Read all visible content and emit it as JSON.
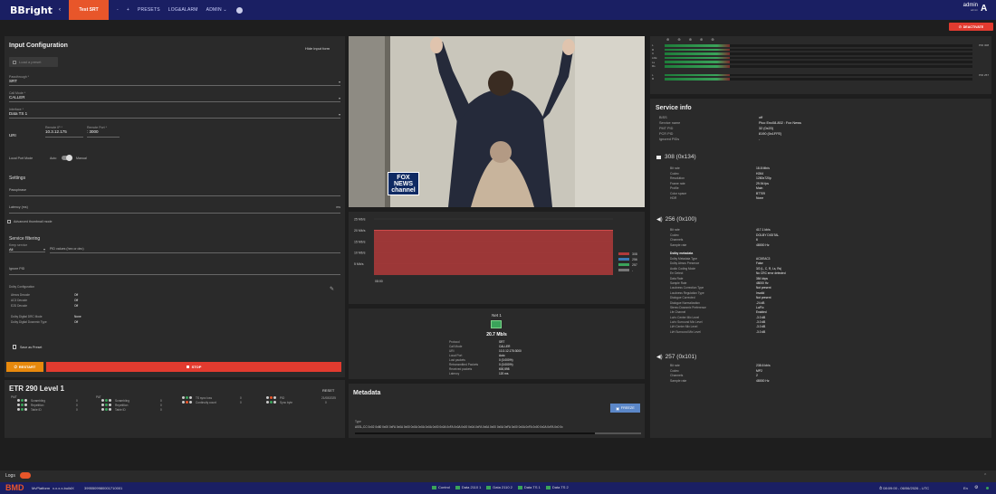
{
  "app": {
    "logo": "BBright",
    "back_icon": "‹",
    "active_tab": "Test SRT",
    "nav": [
      "-",
      "+",
      "PRESETS",
      "LOG&ALARM",
      "ADMIN ⌄"
    ],
    "user": "admin",
    "user_role": "admin",
    "avatar": "A",
    "deactivate": "DEACTIVATE"
  },
  "input": {
    "title": "Input Configuration",
    "hide_link": "Hide input form",
    "load_preset": "Load a preset",
    "fields": [
      {
        "label": "Passthrough *",
        "value": "SRT"
      },
      {
        "label": "Call Mode *",
        "value": "CALLER"
      },
      {
        "label": "Interface *",
        "value": "Data TS 1"
      }
    ],
    "uri_label": "URI",
    "remote_ip_label": "Remote IP *",
    "remote_ip": "10.3.12.175",
    "remote_port_label": "Remote Port *",
    "remote_port": ": 3000",
    "local_port_mode": "Local Port Mode",
    "auto": "Auto",
    "manual": "Manual",
    "settings": "Settings",
    "passphrase": "Passphrase",
    "latency": "Latency (ms)",
    "latency_unit": "ms",
    "adv_thumb": "Advanced thumbnail mode",
    "service_filtering": "Service filtering",
    "keep_service": "Keep service",
    "filter_value": "All",
    "pid_placeholder": "PID values (hex or dec)",
    "ignore_pid": "Ignore PID",
    "dolby_config": "Dolby Configuration",
    "dolby": [
      [
        "Atmos Decode",
        "Off"
      ],
      [
        "AC3 Decode",
        "Off"
      ],
      [
        "E2D Decode",
        "Off"
      ],
      [
        "",
        ""
      ],
      [
        "Dolby Digital DRC Mode",
        "None"
      ],
      [
        "Dolby Digital Downmix Type",
        "Off"
      ]
    ],
    "save_preset": "Save as Preset",
    "restart": "RESTART",
    "stop": "STOP"
  },
  "etr": {
    "title": "ETR 290 Level 1",
    "reset": "RESET",
    "pmt": "PMT",
    "pat": "PAT",
    "date": "21/08/2025",
    "col1": [
      [
        "Scrambling",
        "0"
      ],
      [
        "Repetition",
        "0"
      ],
      [
        "Table ID",
        "0"
      ]
    ],
    "col2": [
      [
        "Scrambling",
        "0"
      ],
      [
        "Repetition",
        "0"
      ],
      [
        "Table ID",
        "0"
      ]
    ],
    "col3": [
      [
        "TS sync loss",
        "0"
      ],
      [
        "Continuity count",
        "0"
      ]
    ],
    "col4": [
      [
        "PID",
        ""
      ],
      [
        "Sync byte",
        "0"
      ]
    ]
  },
  "video": {
    "channel_logo": "FOX NEWS channel"
  },
  "chart_data": {
    "type": "area",
    "ylabels": [
      "25 Mb/s",
      "20 Mb/s",
      "15 Mb/s",
      "10 Mb/s",
      "5 Mb/s"
    ],
    "xlabel": "08:00",
    "legend": [
      {
        "name": "308",
        "color": "#b03a3a"
      },
      {
        "name": "256",
        "color": "#3b78b5"
      },
      {
        "name": "257",
        "color": "#3aa35a"
      },
      {
        "name": "-",
        "color": "#777777"
      }
    ],
    "series": [
      {
        "name": "308",
        "values": [
          20,
          20,
          20
        ]
      }
    ]
  },
  "net": {
    "title": "Net 1",
    "rate": "20.7 Mb/s",
    "rows": [
      [
        "Protocol",
        "SRT"
      ],
      [
        "Call Mode",
        "CALLER"
      ],
      [
        "URI",
        "10.3.12.175:3000"
      ],
      [
        "Local Port",
        "Auto"
      ],
      [
        "Lost packets",
        "0 (0.000%)"
      ],
      [
        "Retransmitted Packets",
        "0 (0.000%)"
      ],
      [
        "Received packets",
        "600,598"
      ],
      [
        "Latency",
        "120 ms"
      ]
    ]
  },
  "metadata": {
    "title": "Metadata",
    "freeze": "FREEZE",
    "type_label": "Type",
    "hex": "ASSL,CC 0x02 0x80 0x00 0xFA 0x0A 0x00 0x0A 0x0A 0x0A 0x00 0x0A 0xFA 0x0A 0x00 0x0A 0xFA 0x0A 0x00 0x0A 0xFA 0x00 0x0A 0xFA 0x00 0x0A 0xFA 0x0 0x"
  },
  "meters": {
    "rows": [
      "L",
      "R",
      "C",
      "LFE",
      "Ls",
      "Rs",
      "L",
      "R"
    ],
    "ends": [
      "PID 308",
      "PID 257"
    ]
  },
  "service": {
    "title": "Service info",
    "rows": [
      [
        "BISS",
        "off"
      ],
      [
        "Service name",
        "Pico Enc08-802 : Fox News"
      ],
      [
        "PMT PID",
        "32 (0x20)"
      ],
      [
        "PCR PID",
        "8190 (0x1FFE)"
      ],
      [
        "Ignored PIDs",
        "-"
      ]
    ],
    "v308": {
      "title": "308 (0x134)",
      "rows": [
        [
          "Bit rate",
          "18.8 Mb/s"
        ],
        [
          "Codec",
          "H264"
        ],
        [
          "Resolution",
          "1280x720p"
        ],
        [
          "Frame rate",
          "29.94 fps"
        ],
        [
          "Profile",
          "Main"
        ],
        [
          "Color space",
          "BT709"
        ],
        [
          "HDR",
          "None"
        ]
      ]
    },
    "a256": {
      "title": "256 (0x100)",
      "rows": [
        [
          "Bit rate",
          "417.1 kb/s"
        ],
        [
          "Codec",
          "DOLBY DIGITAL"
        ],
        [
          "Channels",
          "6"
        ],
        [
          "Sample rate",
          "48000 Hz"
        ]
      ],
      "meta_title": "Dolby metadata",
      "meta": [
        [
          "Dolby Metadata Type",
          "AC3/EAC3"
        ],
        [
          "Dolby Atmos Presence",
          "False"
        ],
        [
          "Audio Coding Mode",
          "3/2 (L, C, R, Ls, Rs)"
        ],
        [
          "Err Detect",
          "No CRC error detected"
        ],
        [
          "Data Rate",
          "384 kbps"
        ],
        [
          "Sample Rate",
          "48000 Hz"
        ],
        [
          "Loudness Correction Type",
          "Not present"
        ],
        [
          "Loudness Regulation Type",
          "Invalid"
        ],
        [
          "Dialogue Corrected",
          "Not present"
        ],
        [
          "Dialogue Normalization",
          "-24 dB"
        ],
        [
          "Stereo Downmix Preference",
          "Lo/Ro"
        ],
        [
          "Lfe Channel",
          "Enabled"
        ],
        [
          "Lo/ro Center Mix Level",
          "-3.0 dB"
        ],
        [
          "Lo/ro Surround Mix Level",
          "-3.0 dB"
        ],
        [
          "Lt/rt Center Mix Level",
          "-3.0 dB"
        ],
        [
          "Lt/rt Surround Mix Level",
          "-3.0 dB"
        ]
      ]
    },
    "a257": {
      "title": "257 (0x101)",
      "rows": [
        [
          "Bit rate",
          "238.6 kb/s"
        ],
        [
          "Codec",
          "MP2"
        ],
        [
          "Channels",
          "2"
        ],
        [
          "Sample rate",
          "48000 Hz"
        ]
      ]
    }
  },
  "logs": "Logs",
  "footer": {
    "logo": "BMD",
    "platform": "MvPlatform",
    "build": "x.x.x.x-buildX",
    "serial": "3995509980001710001",
    "interfaces": [
      "Control",
      "Data 2110 1",
      "Data 2110 2",
      "Data TS 1",
      "Data TS 2"
    ],
    "clock": "⏱ 08:09:00 - 06/06/2026 - UTC",
    "lang": "En"
  }
}
